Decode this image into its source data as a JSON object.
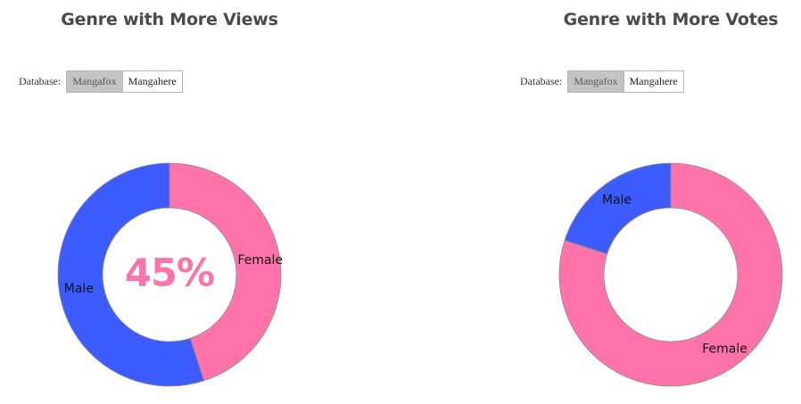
{
  "colors": {
    "female": "#ff73aa",
    "male": "#3d5cff",
    "stroke": "#8a8a8a"
  },
  "database_label": "Database:",
  "database_options": [
    "Mangafox",
    "Mangahere"
  ],
  "views": {
    "title": "Genre with More Views",
    "center_text": "45%",
    "selected_database": "Mangafox"
  },
  "votes": {
    "title": "Genre with More Votes",
    "center_text": "",
    "selected_database": "Mangafox"
  },
  "chart_data": [
    {
      "type": "pie",
      "title": "Genre with More Views",
      "categories": [
        "Female",
        "Male"
      ],
      "values": [
        45,
        55
      ],
      "donut": true,
      "center_label": "45%"
    },
    {
      "type": "pie",
      "title": "Genre with More Votes",
      "categories": [
        "Female",
        "Male"
      ],
      "values": [
        80,
        20
      ],
      "donut": true
    }
  ]
}
